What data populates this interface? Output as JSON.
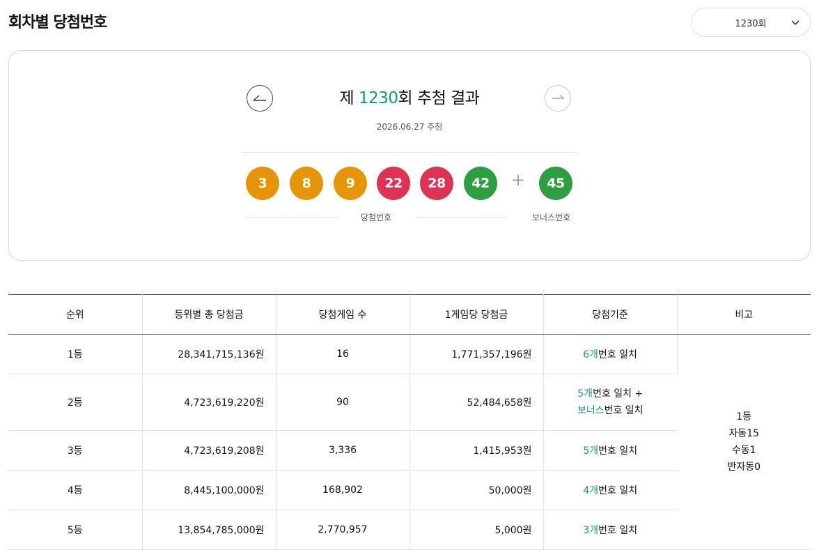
{
  "page": {
    "title": "회차별 당첨번호",
    "round_select": "1230회"
  },
  "draw": {
    "title_prefix": "제 ",
    "round": "1230",
    "title_suffix": "회 추첨 결과",
    "date": "2026.06.27 추첨",
    "numbers": [
      {
        "value": "3",
        "color": "#e69408"
      },
      {
        "value": "8",
        "color": "#e69408"
      },
      {
        "value": "9",
        "color": "#e69408"
      },
      {
        "value": "22",
        "color": "#dc3354"
      },
      {
        "value": "28",
        "color": "#dc3354"
      },
      {
        "value": "42",
        "color": "#2e9e43"
      }
    ],
    "plus": "+",
    "bonus": {
      "value": "45",
      "color": "#2e9e43"
    },
    "winning_label": "당첨번호",
    "bonus_label": "보너스번호"
  },
  "table": {
    "headers": [
      "순위",
      "등위별 총 당첨금",
      "당첨게임 수",
      "1게임당 당첨금",
      "당첨기준",
      "비고"
    ],
    "rows": [
      {
        "rank": "1등",
        "total": "28,341,715,136원",
        "winners": "16",
        "per_game": "1,771,357,196원",
        "criteria_num": "6개",
        "criteria_text": "번호 일치"
      },
      {
        "rank": "2등",
        "total": "4,723,619,220원",
        "winners": "90",
        "per_game": "52,484,658원",
        "criteria_num": "5개",
        "criteria_text": "번호 일치 +",
        "criteria_num2": "보너스",
        "criteria_text2": "번호 일치"
      },
      {
        "rank": "3등",
        "total": "4,723,619,208원",
        "winners": "3,336",
        "per_game": "1,415,953원",
        "criteria_num": "5개",
        "criteria_text": "번호 일치"
      },
      {
        "rank": "4등",
        "total": "8,445,100,000원",
        "winners": "168,902",
        "per_game": "50,000원",
        "criteria_num": "4개",
        "criteria_text": "번호 일치"
      },
      {
        "rank": "5등",
        "total": "13,854,785,000원",
        "winners": "2,770,957",
        "per_game": "5,000원",
        "criteria_num": "3개",
        "criteria_text": "번호 일치"
      }
    ],
    "remark": [
      "1등",
      "자동15",
      "수동1",
      "반자동0"
    ]
  }
}
